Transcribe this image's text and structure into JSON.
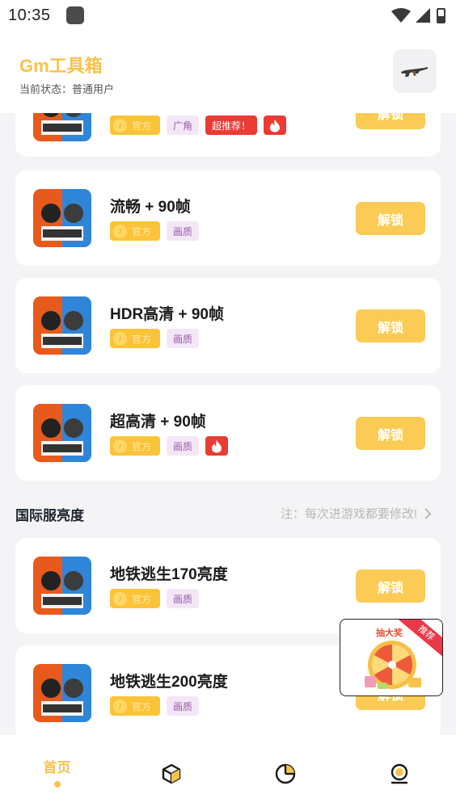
{
  "status_bar": {
    "time": "10:35"
  },
  "header": {
    "title": "Gm工具箱",
    "status": "当前状态：普通用户",
    "tool_icon": "rifle-icon"
  },
  "tags": {
    "official": "官方",
    "wide_angle": "广角",
    "super_recommend": "超推荐！",
    "quality": "画质"
  },
  "unlock_label": "解锁",
  "cards_top": [
    {
      "title": "",
      "tags": [
        "官方",
        "广角",
        "超推荐！",
        "fire"
      ]
    },
    {
      "title": "流畅 + 90帧",
      "tags": [
        "官方",
        "画质"
      ]
    },
    {
      "title": "HDR高清 + 90帧",
      "tags": [
        "官方",
        "画质"
      ]
    },
    {
      "title": "超高清 + 90帧",
      "tags": [
        "官方",
        "画质",
        "fire"
      ]
    }
  ],
  "section": {
    "title": "国际服亮度",
    "note": "注：每次进游戏都要修改!"
  },
  "cards_section": [
    {
      "title": "地铁逃生170亮度",
      "tags": [
        "官方",
        "画质"
      ]
    },
    {
      "title": "地铁逃生200亮度",
      "tags": [
        "官方",
        "画质"
      ]
    }
  ],
  "promo": {
    "ribbon": "推荐",
    "label": "抽大奖"
  },
  "bottom_nav": {
    "home": "首页",
    "items": [
      "home",
      "cube-icon",
      "pie-chart-icon",
      "profile-icon"
    ]
  },
  "colors": {
    "accent": "#f7c34a",
    "unlock_button": "#fbcb55",
    "hot_red": "#ea3b34",
    "quality_tag_bg": "#f3e6f6"
  }
}
